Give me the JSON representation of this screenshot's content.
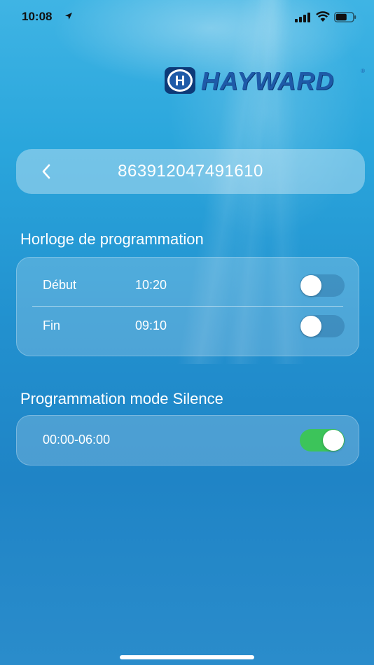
{
  "status_bar": {
    "time": "10:08",
    "icons": [
      "location-arrow-icon",
      "cellular-signal-icon",
      "wifi-icon",
      "battery-icon"
    ]
  },
  "brand": {
    "name": "HAYWARD",
    "badge_letter": "H",
    "reg_mark": "®",
    "color": "#1e5aa8"
  },
  "header": {
    "back_icon": "chevron-left-icon",
    "device_id": "863912047491610"
  },
  "clock_section": {
    "title": "Horloge de programmation",
    "rows": [
      {
        "label": "Début",
        "value": "10:20",
        "enabled": false
      },
      {
        "label": "Fin",
        "value": "09:10",
        "enabled": false
      }
    ]
  },
  "silence_section": {
    "title": "Programmation mode Silence",
    "rows": [
      {
        "value": "00:00-06:00",
        "enabled": true
      }
    ]
  },
  "colors": {
    "toggle_on": "#3cc45a",
    "background_top": "#3fb4e4",
    "background_bottom": "#1f84c6"
  }
}
